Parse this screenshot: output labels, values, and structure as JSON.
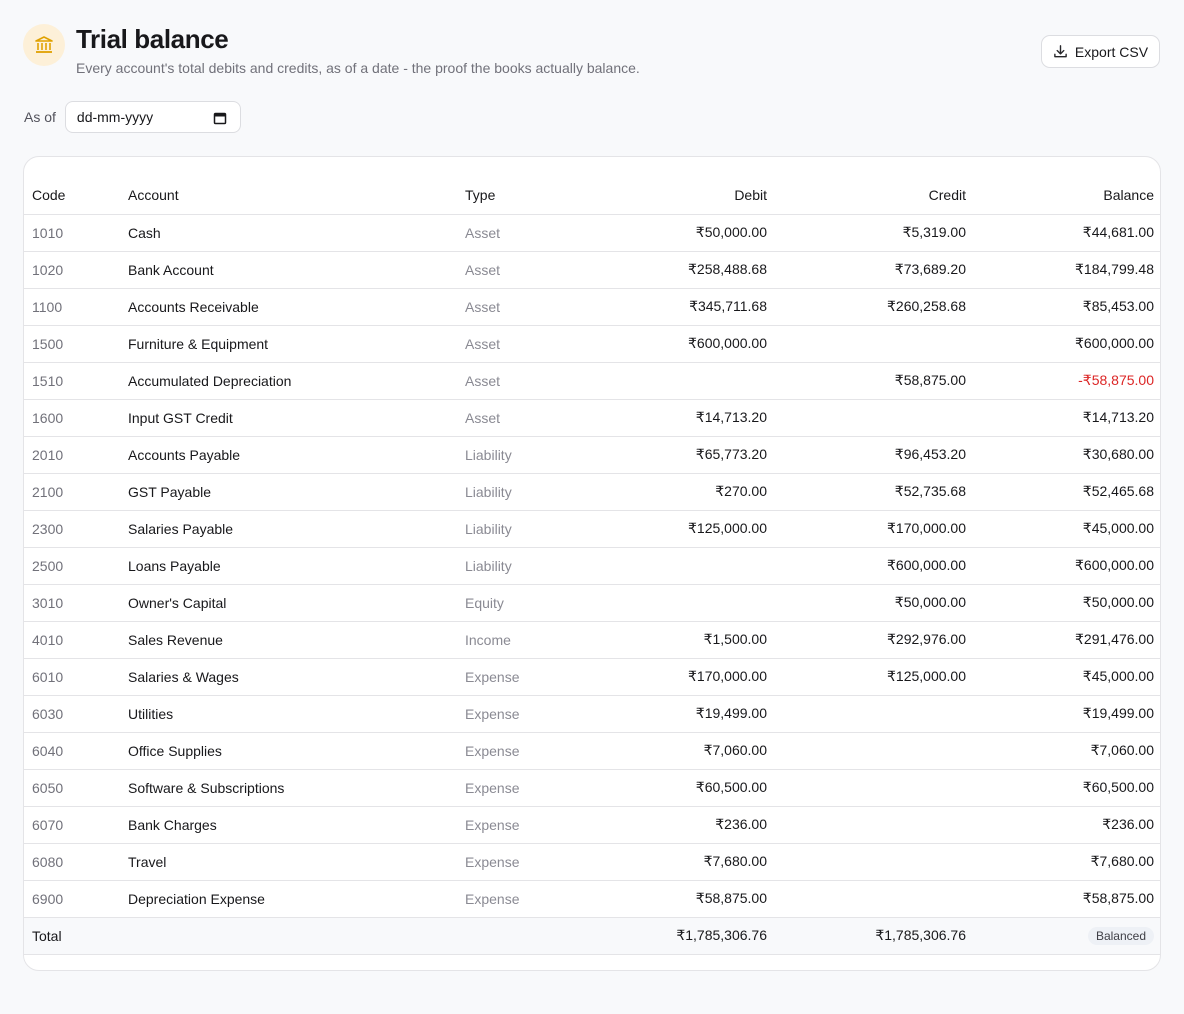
{
  "header": {
    "title": "Trial balance",
    "subtitle": "Every account's total debits and credits, as of a date - the proof the books actually balance.",
    "export_label": "Export CSV",
    "icon": "bank-icon"
  },
  "filter": {
    "as_of_label": "As of",
    "date_placeholder": "dd-mm-yyyy"
  },
  "table": {
    "columns": {
      "code": "Code",
      "account": "Account",
      "type": "Type",
      "debit": "Debit",
      "credit": "Credit",
      "balance": "Balance"
    },
    "rows": [
      {
        "code": "1010",
        "account": "Cash",
        "type": "Asset",
        "debit": "₹50,000.00",
        "credit": "₹5,319.00",
        "balance": "₹44,681.00",
        "negative": false
      },
      {
        "code": "1020",
        "account": "Bank Account",
        "type": "Asset",
        "debit": "₹258,488.68",
        "credit": "₹73,689.20",
        "balance": "₹184,799.48",
        "negative": false
      },
      {
        "code": "1100",
        "account": "Accounts Receivable",
        "type": "Asset",
        "debit": "₹345,711.68",
        "credit": "₹260,258.68",
        "balance": "₹85,453.00",
        "negative": false
      },
      {
        "code": "1500",
        "account": "Furniture & Equipment",
        "type": "Asset",
        "debit": "₹600,000.00",
        "credit": "",
        "balance": "₹600,000.00",
        "negative": false
      },
      {
        "code": "1510",
        "account": "Accumulated Depreciation",
        "type": "Asset",
        "debit": "",
        "credit": "₹58,875.00",
        "balance": "-₹58,875.00",
        "negative": true
      },
      {
        "code": "1600",
        "account": "Input GST Credit",
        "type": "Asset",
        "debit": "₹14,713.20",
        "credit": "",
        "balance": "₹14,713.20",
        "negative": false
      },
      {
        "code": "2010",
        "account": "Accounts Payable",
        "type": "Liability",
        "debit": "₹65,773.20",
        "credit": "₹96,453.20",
        "balance": "₹30,680.00",
        "negative": false
      },
      {
        "code": "2100",
        "account": "GST Payable",
        "type": "Liability",
        "debit": "₹270.00",
        "credit": "₹52,735.68",
        "balance": "₹52,465.68",
        "negative": false
      },
      {
        "code": "2300",
        "account": "Salaries Payable",
        "type": "Liability",
        "debit": "₹125,000.00",
        "credit": "₹170,000.00",
        "balance": "₹45,000.00",
        "negative": false
      },
      {
        "code": "2500",
        "account": "Loans Payable",
        "type": "Liability",
        "debit": "",
        "credit": "₹600,000.00",
        "balance": "₹600,000.00",
        "negative": false
      },
      {
        "code": "3010",
        "account": "Owner's Capital",
        "type": "Equity",
        "debit": "",
        "credit": "₹50,000.00",
        "balance": "₹50,000.00",
        "negative": false
      },
      {
        "code": "4010",
        "account": "Sales Revenue",
        "type": "Income",
        "debit": "₹1,500.00",
        "credit": "₹292,976.00",
        "balance": "₹291,476.00",
        "negative": false
      },
      {
        "code": "6010",
        "account": "Salaries & Wages",
        "type": "Expense",
        "debit": "₹170,000.00",
        "credit": "₹125,000.00",
        "balance": "₹45,000.00",
        "negative": false
      },
      {
        "code": "6030",
        "account": "Utilities",
        "type": "Expense",
        "debit": "₹19,499.00",
        "credit": "",
        "balance": "₹19,499.00",
        "negative": false
      },
      {
        "code": "6040",
        "account": "Office Supplies",
        "type": "Expense",
        "debit": "₹7,060.00",
        "credit": "",
        "balance": "₹7,060.00",
        "negative": false
      },
      {
        "code": "6050",
        "account": "Software & Subscriptions",
        "type": "Expense",
        "debit": "₹60,500.00",
        "credit": "",
        "balance": "₹60,500.00",
        "negative": false
      },
      {
        "code": "6070",
        "account": "Bank Charges",
        "type": "Expense",
        "debit": "₹236.00",
        "credit": "",
        "balance": "₹236.00",
        "negative": false
      },
      {
        "code": "6080",
        "account": "Travel",
        "type": "Expense",
        "debit": "₹7,680.00",
        "credit": "",
        "balance": "₹7,680.00",
        "negative": false
      },
      {
        "code": "6900",
        "account": "Depreciation Expense",
        "type": "Expense",
        "debit": "₹58,875.00",
        "credit": "",
        "balance": "₹58,875.00",
        "negative": false
      }
    ],
    "total": {
      "label": "Total",
      "debit": "₹1,785,306.76",
      "credit": "₹1,785,306.76",
      "status": "Balanced"
    }
  },
  "colors": {
    "negative": "#dc2626",
    "icon_bg": "#fdf0d8",
    "icon_fg": "#e0a100",
    "badge_bg": "#eef1f6"
  }
}
